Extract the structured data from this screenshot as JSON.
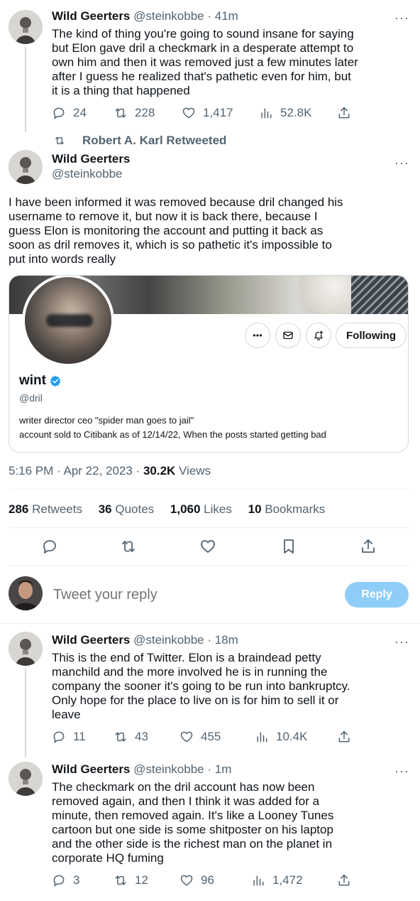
{
  "tweet1": {
    "name": "Wild Geerters",
    "handle": "@steinkobbe",
    "time": "41m",
    "line1": "The kind of thing you're going to sound insane for saying",
    "line2": "but Elon gave dril a checkmark in a desperate attempt to",
    "line3": "own him and then it was removed just a few minutes later",
    "line4": "after I guess he realized that's pathetic even for him, but",
    "line5": "it is a thing that happened",
    "replies": "24",
    "retweets": "228",
    "likes": "1,417",
    "views": "52.8K"
  },
  "retweet_banner": "Robert A. Karl Retweeted",
  "main_tweet": {
    "name": "Wild Geerters",
    "handle": "@steinkobbe",
    "line1": "I have been informed it was removed because dril changed his",
    "line2": "username to remove it, but now it is back there, because I",
    "line3": "guess Elon is monitoring the account and putting it back as",
    "line4": "soon as dril removes it, which is so pathetic it's impossible to",
    "line5": "put into words really",
    "card": {
      "display_name": "wint",
      "handle": "@dril",
      "bio1": "writer director ceo \"spider man goes to jail\"",
      "bio2": "account sold to Citibank as of 12/14/22, When the posts started getting bad",
      "following_label": "Following"
    },
    "time": "5:16 PM · Apr 22, 2023 · ",
    "views_count": "30.2K",
    "views_label": " Views",
    "retweets_count": "286",
    "retweets_label": " Retweets",
    "quotes_count": "36",
    "quotes_label": " Quotes",
    "likes_count": "1,060",
    "likes_label": " Likes",
    "bookmarks_count": "10",
    "bookmarks_label": " Bookmarks"
  },
  "reply_box": {
    "placeholder": "Tweet your reply",
    "button": "Reply"
  },
  "tweet3": {
    "name": "Wild Geerters",
    "handle": "@steinkobbe",
    "time": "18m",
    "line1": "This is the end of Twitter. Elon is a braindead petty",
    "line2": "manchild and the more involved he is in running the",
    "line3": "company the sooner it's going to be run into bankruptcy.",
    "line4": "Only hope for the place to live on is for him to sell it or",
    "line5": "leave",
    "replies": "11",
    "retweets": "43",
    "likes": "455",
    "views": "10.4K"
  },
  "tweet4": {
    "name": "Wild Geerters",
    "handle": "@steinkobbe",
    "time": "1m",
    "line1": "The checkmark on the dril account has now been",
    "line2": "removed again, and then I think it was added for a",
    "line3": "minute, then removed again. It's like a Looney Tunes",
    "line4": "cartoon but one side is some shitposter on his laptop",
    "line5": "and the other side is the richest man on the planet in",
    "line6": "corporate HQ fuming",
    "replies": "3",
    "retweets": "12",
    "likes": "96",
    "views": "1,472"
  },
  "colors": {
    "text": "#0f1419",
    "secondary": "#536471",
    "accent": "#1d9bf0",
    "reply_button": "#8ecdf8",
    "border": "#cfd9de"
  }
}
